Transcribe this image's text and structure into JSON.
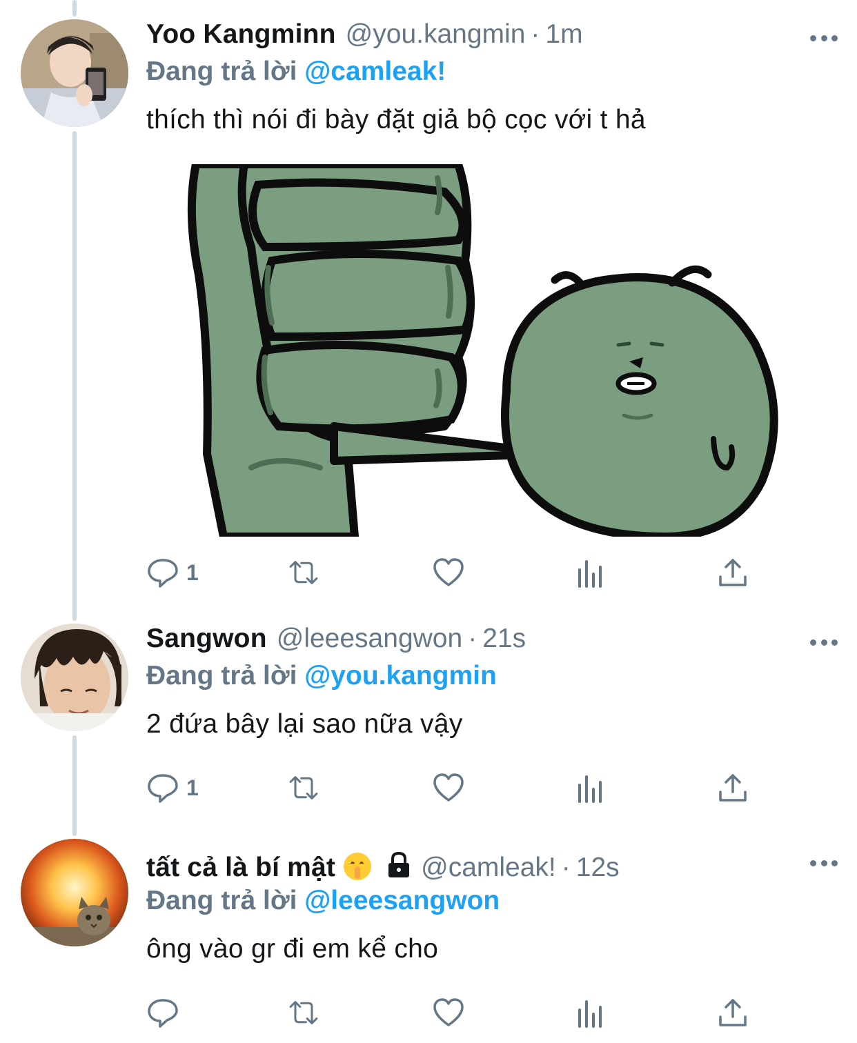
{
  "tweets": [
    {
      "name": "Yoo Kangminn",
      "handle": "@you.kangmin",
      "time": "1m",
      "reply_prefix": "Đang trả lời",
      "reply_to": "@camleak!",
      "text": "thích thì nói đi bày đặt giả bộ cọc với t hả",
      "reply_count": "1"
    },
    {
      "name": "Sangwon",
      "handle": "@leeesangwon",
      "time": "21s",
      "reply_prefix": "Đang trả lời",
      "reply_to": "@you.kangmin",
      "text": "2 đứa bây lại sao nữa vậy",
      "reply_count": "1"
    },
    {
      "name": "tất cả là bí mật",
      "handle": "@camleak!",
      "time": "12s",
      "reply_prefix": "Đang trả lời",
      "reply_to": "@leeesangwon",
      "text": "ông vào gr đi em kể cho",
      "reply_count": ""
    }
  ],
  "separator": "·",
  "icons": [
    "more-icon",
    "reply-icon",
    "retweet-icon",
    "like-icon",
    "analytics-icon",
    "share-icon",
    "shushing-face-emoji",
    "lock-icon"
  ],
  "colors": {
    "text": "#14171a",
    "secondary": "#657786",
    "mention": "#1da1f2",
    "thread_line": "#cfd9de",
    "sticker_green": "#7b9e80"
  }
}
